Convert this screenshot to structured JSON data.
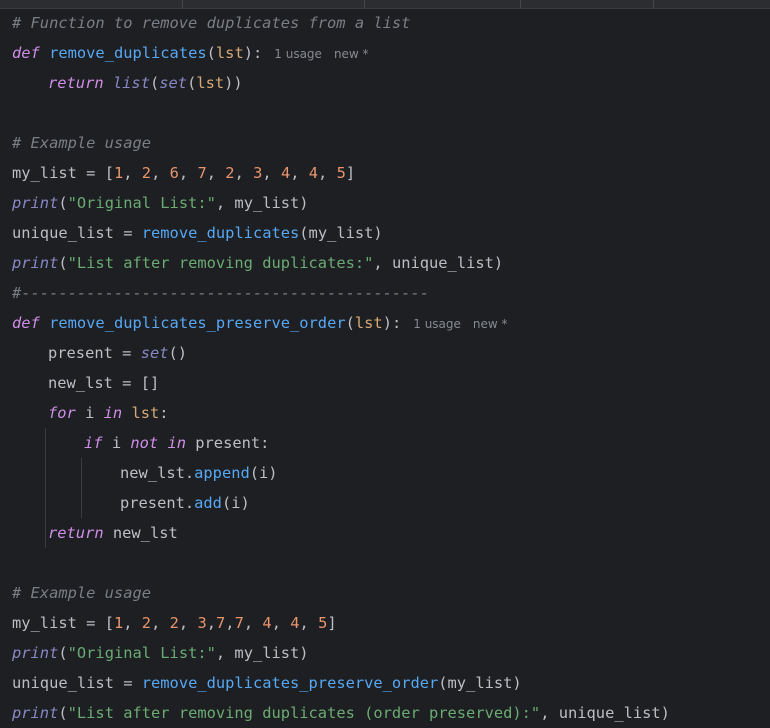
{
  "code": {
    "l1_comment": "# Function to remove duplicates from a list",
    "l2": {
      "kw": "def",
      "fn": "remove_duplicates",
      "open": "(",
      "param": "lst",
      "close": "):",
      "hint_usage": "1 usage",
      "hint_new": "new *"
    },
    "l3": {
      "kw": "return",
      "list": "list",
      "p1": "(",
      "set": "set",
      "p2": "(",
      "arg": "lst",
      "close": "))"
    },
    "l5_comment": "# Example usage",
    "l6": {
      "var": "my_list",
      "eq": " = ",
      "lb": "[",
      "n1": "1",
      "n2": "2",
      "n3": "6",
      "n4": "7",
      "n5": "2",
      "n6": "3",
      "n7": "4",
      "n8": "4",
      "n9": "5",
      "rb": "]",
      "sep": ", "
    },
    "l7": {
      "print": "print",
      "open": "(",
      "str": "\"Original List:\"",
      "rest": ", my_list)"
    },
    "l8": {
      "var": "unique_list",
      "eq": " = ",
      "fn": "remove_duplicates",
      "rest": "(my_list)"
    },
    "l9": {
      "print": "print",
      "open": "(",
      "str": "\"List after removing duplicates:\"",
      "rest": ", unique_list)"
    },
    "l10_comment": "#--------------------------------------------",
    "l11": {
      "kw": "def",
      "fn": "remove_duplicates_preserve_order",
      "open": "(",
      "param": "lst",
      "close": "):",
      "hint_usage": "1 usage",
      "hint_new": "new *"
    },
    "l12": {
      "var": "present",
      "eq": " = ",
      "set": "set",
      "rest": "()"
    },
    "l13": {
      "var": "new_lst",
      "eq": " = ",
      "rest": "[]"
    },
    "l14": {
      "kw_for": "for",
      "i": " i ",
      "kw_in": "in",
      "sp": " ",
      "param": "lst",
      "colon": ":"
    },
    "l15": {
      "kw_if": "if",
      "i": " i ",
      "kw_not": "not",
      "sp1": " ",
      "kw_in": "in",
      "rest": " present:"
    },
    "l16": {
      "obj": "new_lst.",
      "fn": "append",
      "rest": "(i)"
    },
    "l17": {
      "obj": "present.",
      "fn": "add",
      "rest": "(i)"
    },
    "l18": {
      "kw": "return",
      "rest": " new_lst"
    },
    "l20_comment": "# Example usage",
    "l21": {
      "var": "my_list",
      "eq": " = ",
      "lb": "[",
      "n1": "1",
      "n2": "2",
      "n3": "2",
      "n4": "3",
      "n5": "7",
      "n6": "7",
      "n7": "4",
      "n8": "4",
      "n9": "5",
      "rb": "]",
      "sep": ", ",
      "sepc": ","
    },
    "l22": {
      "print": "print",
      "open": "(",
      "str": "\"Original List:\"",
      "rest": ", my_list)"
    },
    "l23": {
      "var": "unique_list",
      "eq": " = ",
      "fn": "remove_duplicates_preserve_order",
      "rest": "(my_list)"
    },
    "l24": {
      "print": "print",
      "open": "(",
      "str": "\"List after removing duplicates (order preserved):\"",
      "rest": ", unique_list)"
    }
  }
}
